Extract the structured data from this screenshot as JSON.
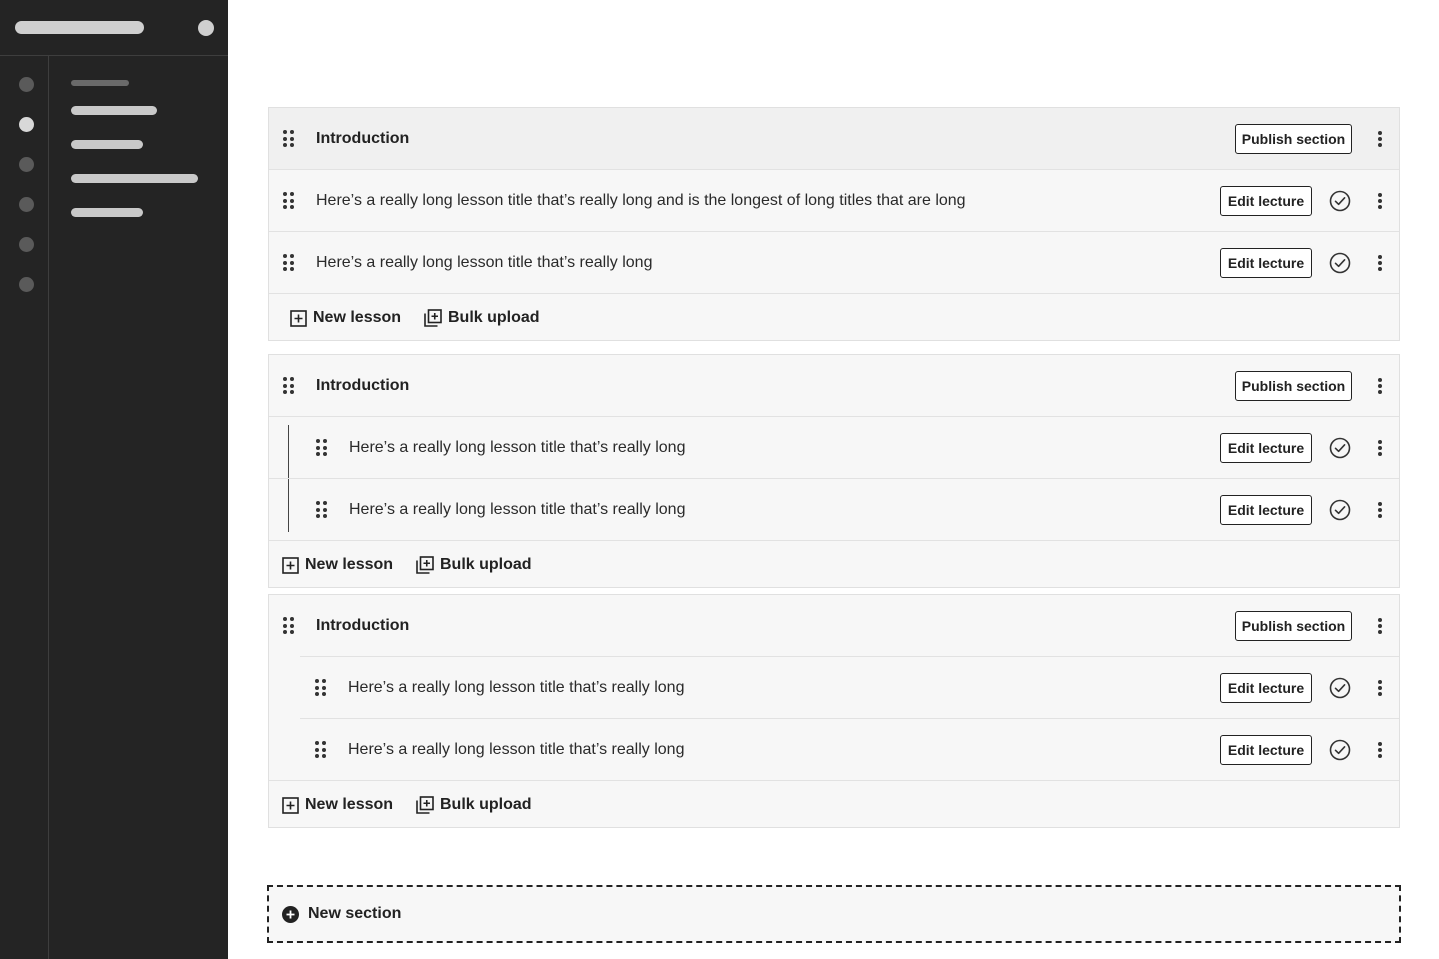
{
  "sections": [
    {
      "title": "Introduction",
      "publish_label": "Publish section",
      "lessons": [
        {
          "title": "Here’s a really long lesson title that’s really long and is the longest of long titles that are long",
          "edit_label": "Edit lecture"
        },
        {
          "title": "Here’s a really long lesson title that’s really long",
          "edit_label": "Edit lecture"
        }
      ],
      "actions": {
        "new_lesson": "New lesson",
        "bulk_upload": "Bulk upload"
      }
    },
    {
      "title": "Introduction",
      "publish_label": "Publish section",
      "lessons": [
        {
          "title": "Here’s a really long lesson title that’s really long",
          "edit_label": "Edit lecture"
        },
        {
          "title": "Here’s a really long lesson title that’s really long",
          "edit_label": "Edit lecture"
        }
      ],
      "actions": {
        "new_lesson": "New lesson",
        "bulk_upload": "Bulk upload"
      }
    },
    {
      "title": "Introduction",
      "publish_label": "Publish section",
      "lessons": [
        {
          "title": "Here’s a really long lesson title that’s really long",
          "edit_label": "Edit lecture"
        },
        {
          "title": "Here’s a really long lesson title that’s really long",
          "edit_label": "Edit lecture"
        }
      ],
      "actions": {
        "new_lesson": "New lesson",
        "bulk_upload": "Bulk upload"
      }
    }
  ],
  "new_section_label": "New section",
  "icons": {
    "drag": "drag-handle-icon",
    "check": "check-circle-icon",
    "kebab": "more-vertical-icon",
    "new_lesson": "plus-square-icon",
    "bulk_upload": "stacked-plus-icon",
    "new_section": "plus-circle-icon"
  }
}
